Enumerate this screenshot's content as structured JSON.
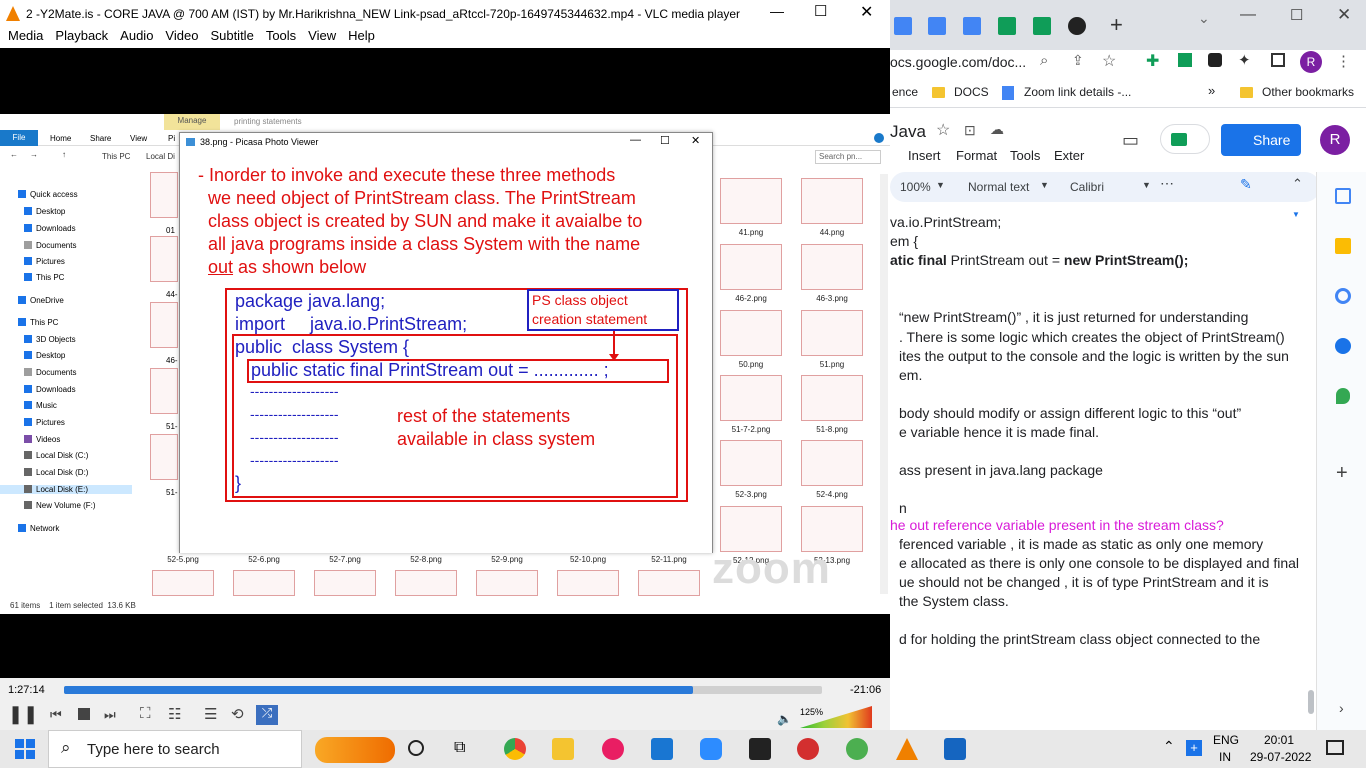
{
  "vlc": {
    "title": "2 -Y2Mate.is - CORE JAVA @ 700 AM (IST) by Mr.Harikrishna_NEW Link-psad_aRtccl-720p-1649745344632.mp4 - VLC media player",
    "menu": [
      "Media",
      "Playback",
      "Audio",
      "Video",
      "Subtitle",
      "Tools",
      "View",
      "Help"
    ],
    "time_elapsed": "1:27:14",
    "time_remaining": "-21:06",
    "progress": 0.83,
    "volume": "125%"
  },
  "explorer": {
    "ribbon_manage": "Manage",
    "ribbon_context": "printing statements",
    "tabs": [
      "File",
      "Home",
      "Share",
      "View",
      "Pi"
    ],
    "breadcrumb": [
      "This PC",
      "Local Di"
    ],
    "search_placeholder": "Search pn...",
    "nav_items": [
      {
        "label": "Quick access",
        "icon": "star-icon"
      },
      {
        "label": "Desktop",
        "icon": "folder-icon"
      },
      {
        "label": "Downloads",
        "icon": "download-icon"
      },
      {
        "label": "Documents",
        "icon": "document-icon"
      },
      {
        "label": "Pictures",
        "icon": "picture-icon"
      },
      {
        "label": "This PC",
        "icon": "pc-icon"
      },
      {
        "label": "OneDrive",
        "icon": "cloud-icon"
      },
      {
        "label": "This PC",
        "icon": "pc-icon"
      },
      {
        "label": "3D Objects",
        "icon": "cube-icon"
      },
      {
        "label": "Desktop",
        "icon": "folder-icon"
      },
      {
        "label": "Documents",
        "icon": "document-icon"
      },
      {
        "label": "Downloads",
        "icon": "download-icon"
      },
      {
        "label": "Music",
        "icon": "music-icon"
      },
      {
        "label": "Pictures",
        "icon": "picture-icon"
      },
      {
        "label": "Videos",
        "icon": "video-icon"
      },
      {
        "label": "Local Disk (C:)",
        "icon": "disk-icon"
      },
      {
        "label": "Local Disk (D:)",
        "icon": "disk-icon"
      },
      {
        "label": "Local Disk (E:)",
        "icon": "disk-icon"
      },
      {
        "label": "New Volume (F:)",
        "icon": "disk-icon"
      },
      {
        "label": "Network",
        "icon": "network-icon"
      }
    ],
    "right_files": [
      "41.png",
      "44.png",
      "46-2.png",
      "46-3.png",
      "50.png",
      "51.png",
      "51-7-2.png",
      "51-8.png",
      "52-3.png",
      "52-4.png",
      "52-12.png",
      "52-13.png"
    ],
    "bottom_files": [
      "52-5.png",
      "52-6.png",
      "52-7.png",
      "52-8.png",
      "52-9.png",
      "52-10.png",
      "52-11.png"
    ],
    "left_partial": [
      "01",
      "44-",
      "46-",
      "51-",
      "51-"
    ],
    "status": "61 items    1 item selected  13.6 KB",
    "zoom_watermark": "zoom"
  },
  "picasa": {
    "title": "38.png - Picasa Photo Viewer",
    "line1": "- Inorder to invoke and execute these three methods",
    "line2": "we need object of PrintStream class. The PrintStream",
    "line3": "class object is created by SUN and make it avaialbe to",
    "line4": "all java programs inside a class System with the name",
    "line5_u": "out",
    "line5": " as shown below",
    "code1": "package java.lang;",
    "code2": "import     java.io.PrintStream;",
    "code3": "public  class System {",
    "code4": "public static final PrintStream out = ............. ;",
    "dashes": "-------------------",
    "note_box": "PS class object creation statement",
    "rest1": "rest of the statements",
    "rest2": "available in class system",
    "close_brace": "}"
  },
  "chrome": {
    "url": "ocs.google.com/doc...",
    "bookmarks": [
      "ence",
      "DOCS",
      "Zoom link details -...",
      "Other bookmarks"
    ],
    "doc_title": "Java",
    "doc_menu": [
      "Insert",
      "Format",
      "Tools",
      "Exter"
    ],
    "share_label": "Share",
    "avatar": "R",
    "zoom": "100%",
    "style": "Normal text",
    "font": "Calibri"
  },
  "doc": {
    "l1a": "va.io.PrintStream;",
    "l2a": "em {",
    "l3b": "atic final",
    "l3c": " PrintStream out = ",
    "l3d": "new PrintStream();",
    "p1": "“new PrintStream()” , it is just returned for understanding",
    "p2": ". There is some logic which creates the object of PrintStream()",
    "p3": "ites the output to the console and the logic is written by the sun",
    "p4": "em.",
    "p5": "body should modify or assign different logic to this “out”",
    "p6": "e variable  hence it is made final.",
    "p7": "ass present in java.lang package",
    "p8": "n",
    "q": "he out reference variable present in the stream class?",
    "a1": "ferenced variable ,  it is made as static as only one memory",
    "a2": "e allocated as there is only one console to be displayed and final",
    "a3": "ue should not be changed , it is of type PrintStream and it is",
    "a4": " the System class.",
    "a5": "d  for holding the printStream class object connected to the"
  },
  "taskbar": {
    "search_placeholder": "Type here to search",
    "lang1": "ENG",
    "lang2": "IN",
    "time": "20:01",
    "date": "29-07-2022"
  }
}
